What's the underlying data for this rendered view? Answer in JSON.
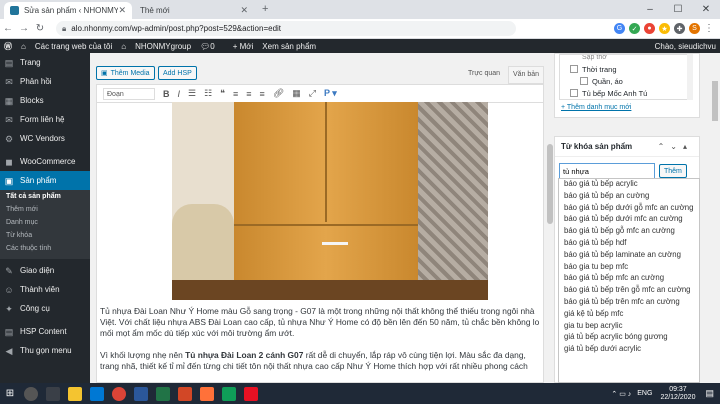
{
  "browser": {
    "tabs": [
      {
        "label": "Sửa sản phẩm ‹ NHONMYgroup"
      },
      {
        "label": "Thẻ mới"
      }
    ],
    "new_tab": "+",
    "url": "alo.nhonmy.com/wp-admin/post.php?post=529&action=edit"
  },
  "admin_bar": {
    "site": "Các trang web của tôi",
    "site_name": "NHONMYgroup",
    "comments": "0",
    "new": "+ Mới",
    "view": "Xem sản phẩm",
    "greeting": "Chào, sieudichvu"
  },
  "sidebar": {
    "items": [
      {
        "label": "Trang",
        "icon": "page-icon"
      },
      {
        "label": "Phản hồi",
        "icon": "comment-icon"
      },
      {
        "label": "Blocks",
        "icon": "blocks-icon"
      },
      {
        "label": "Form liên hệ",
        "icon": "form-icon"
      },
      {
        "label": "WC Vendors",
        "icon": "vendors-icon"
      },
      {
        "label": "WooCommerce",
        "icon": "woo-icon"
      },
      {
        "label": "Sản phẩm",
        "icon": "product-icon"
      }
    ],
    "subitems": [
      "Tất cả sản phẩm",
      "Thêm mới",
      "Danh mục",
      "Từ khóa",
      "Các thuộc tính"
    ],
    "items2": [
      {
        "label": "Giao diện",
        "icon": "brush-icon"
      },
      {
        "label": "Thành viên",
        "icon": "users-icon"
      },
      {
        "label": "Công cụ",
        "icon": "tools-icon"
      },
      {
        "label": "HSP Content",
        "icon": "hsp-icon"
      },
      {
        "label": "Thu gọn menu",
        "icon": "collapse-icon"
      }
    ]
  },
  "editor": {
    "add_media": "Thêm Media",
    "add_hsp": "Add HSP",
    "tab_visual": "Trực quan",
    "tab_text": "Văn bản",
    "format": "Đoạn",
    "para1": "Tủ nhựa Đài Loan Như Ý Home màu Gỗ sang trọng - G07 là một trong những nội thất không thể thiếu trong ngôi nhà Việt. Với chất liệu nhựa ABS Đài Loan cao cấp, tủ nhựa Như Ý Home có độ bền lên đến 50 năm, tủ chắc bền không lo mối mọt ẩm mốc dù tiếp xúc với môi trường ẩm ướt.",
    "para2a": "Vì khối lượng nhẹ nên ",
    "para2b": "Tủ nhựa Đài Loan 2 cánh G07",
    "para2c": " rất dễ di chuyển, lắp ráp vô cùng tiện lợi. Màu sắc đa dạng, trang nhã, thiết kế tỉ mỉ đến từng chi tiết tôn nội thất nhựa cao cấp Như Ý Home thích hợp với rất nhiều phong cách"
  },
  "categories": {
    "items": [
      "Sập thờ",
      "Thời trang",
      "Quần, áo",
      "Tủ bếp Mốc Anh Tú"
    ],
    "add_link": "+ Thêm danh mục mới"
  },
  "tags": {
    "title": "Từ khóa sản phẩm",
    "input_value": "tủ nhựa",
    "add_button": "Thêm",
    "suggestions": [
      "báo giá tủ bếp acrylic",
      "báo giá tủ bếp an cường",
      "báo giá tủ bếp dưới gỗ mfc an cường",
      "báo giá tủ bếp dưới mfc an cường",
      "báo giá tủ bếp gỗ mfc an cường",
      "báo giá tủ bếp hdf",
      "báo giá tủ bếp laminate an cường",
      "báo gia tu bep mfc",
      "báo giá tủ bếp mfc an cường",
      "báo giá tủ bếp trên gỗ mfc an cường",
      "báo giá tủ bếp trên mfc an cường",
      "giá kệ tủ bếp mfc",
      "gia tu bep acrylic",
      "giá tủ bếp acrylic bóng gương",
      "giá tủ bếp dưới acrylic"
    ]
  },
  "taskbar": {
    "lang": "ENG",
    "time": "09:37",
    "date": "22/12/2020"
  }
}
